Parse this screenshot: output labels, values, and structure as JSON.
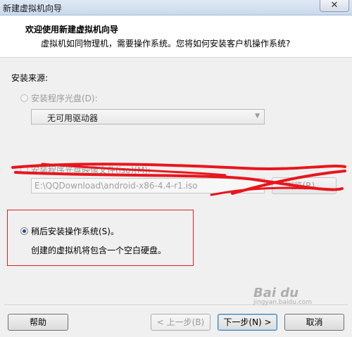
{
  "window": {
    "title": "新建虚拟机向导",
    "close_symbol": "✕"
  },
  "header": {
    "title": "欢迎使用新建虚拟机向导",
    "subtitle": "虚拟机如同物理机，需要操作系统。您将如何安装客户机操作系统?"
  },
  "install_source": {
    "label": "安装来源:",
    "disc_option": {
      "label": "安装程序光盘(D):",
      "selected": false,
      "enabled": false,
      "drive_value": "无可用驱动器"
    },
    "image_option": {
      "label": "安装程序光盘映像文件(iso)(M):",
      "selected": false,
      "enabled": false,
      "path_value": "E:\\QQDownload\\android-x86-4.4-r1.iso",
      "browse_label": "浏览(R)..."
    },
    "later_option": {
      "label": "稍后安装操作系统(S)。",
      "selected": true,
      "description": "创建的虚拟机将包含一个空白硬盘。"
    }
  },
  "buttons": {
    "help": "帮助",
    "back": "< 上一步(B)",
    "next": "下一步(N) >",
    "cancel": "取消"
  },
  "watermark": {
    "brand": "Bai du",
    "sub": "jingyan.baidu.com"
  },
  "colors": {
    "scribble": "#e8161c",
    "highlight_box": "#e02020",
    "radio_checked": "#1d4f9e"
  }
}
